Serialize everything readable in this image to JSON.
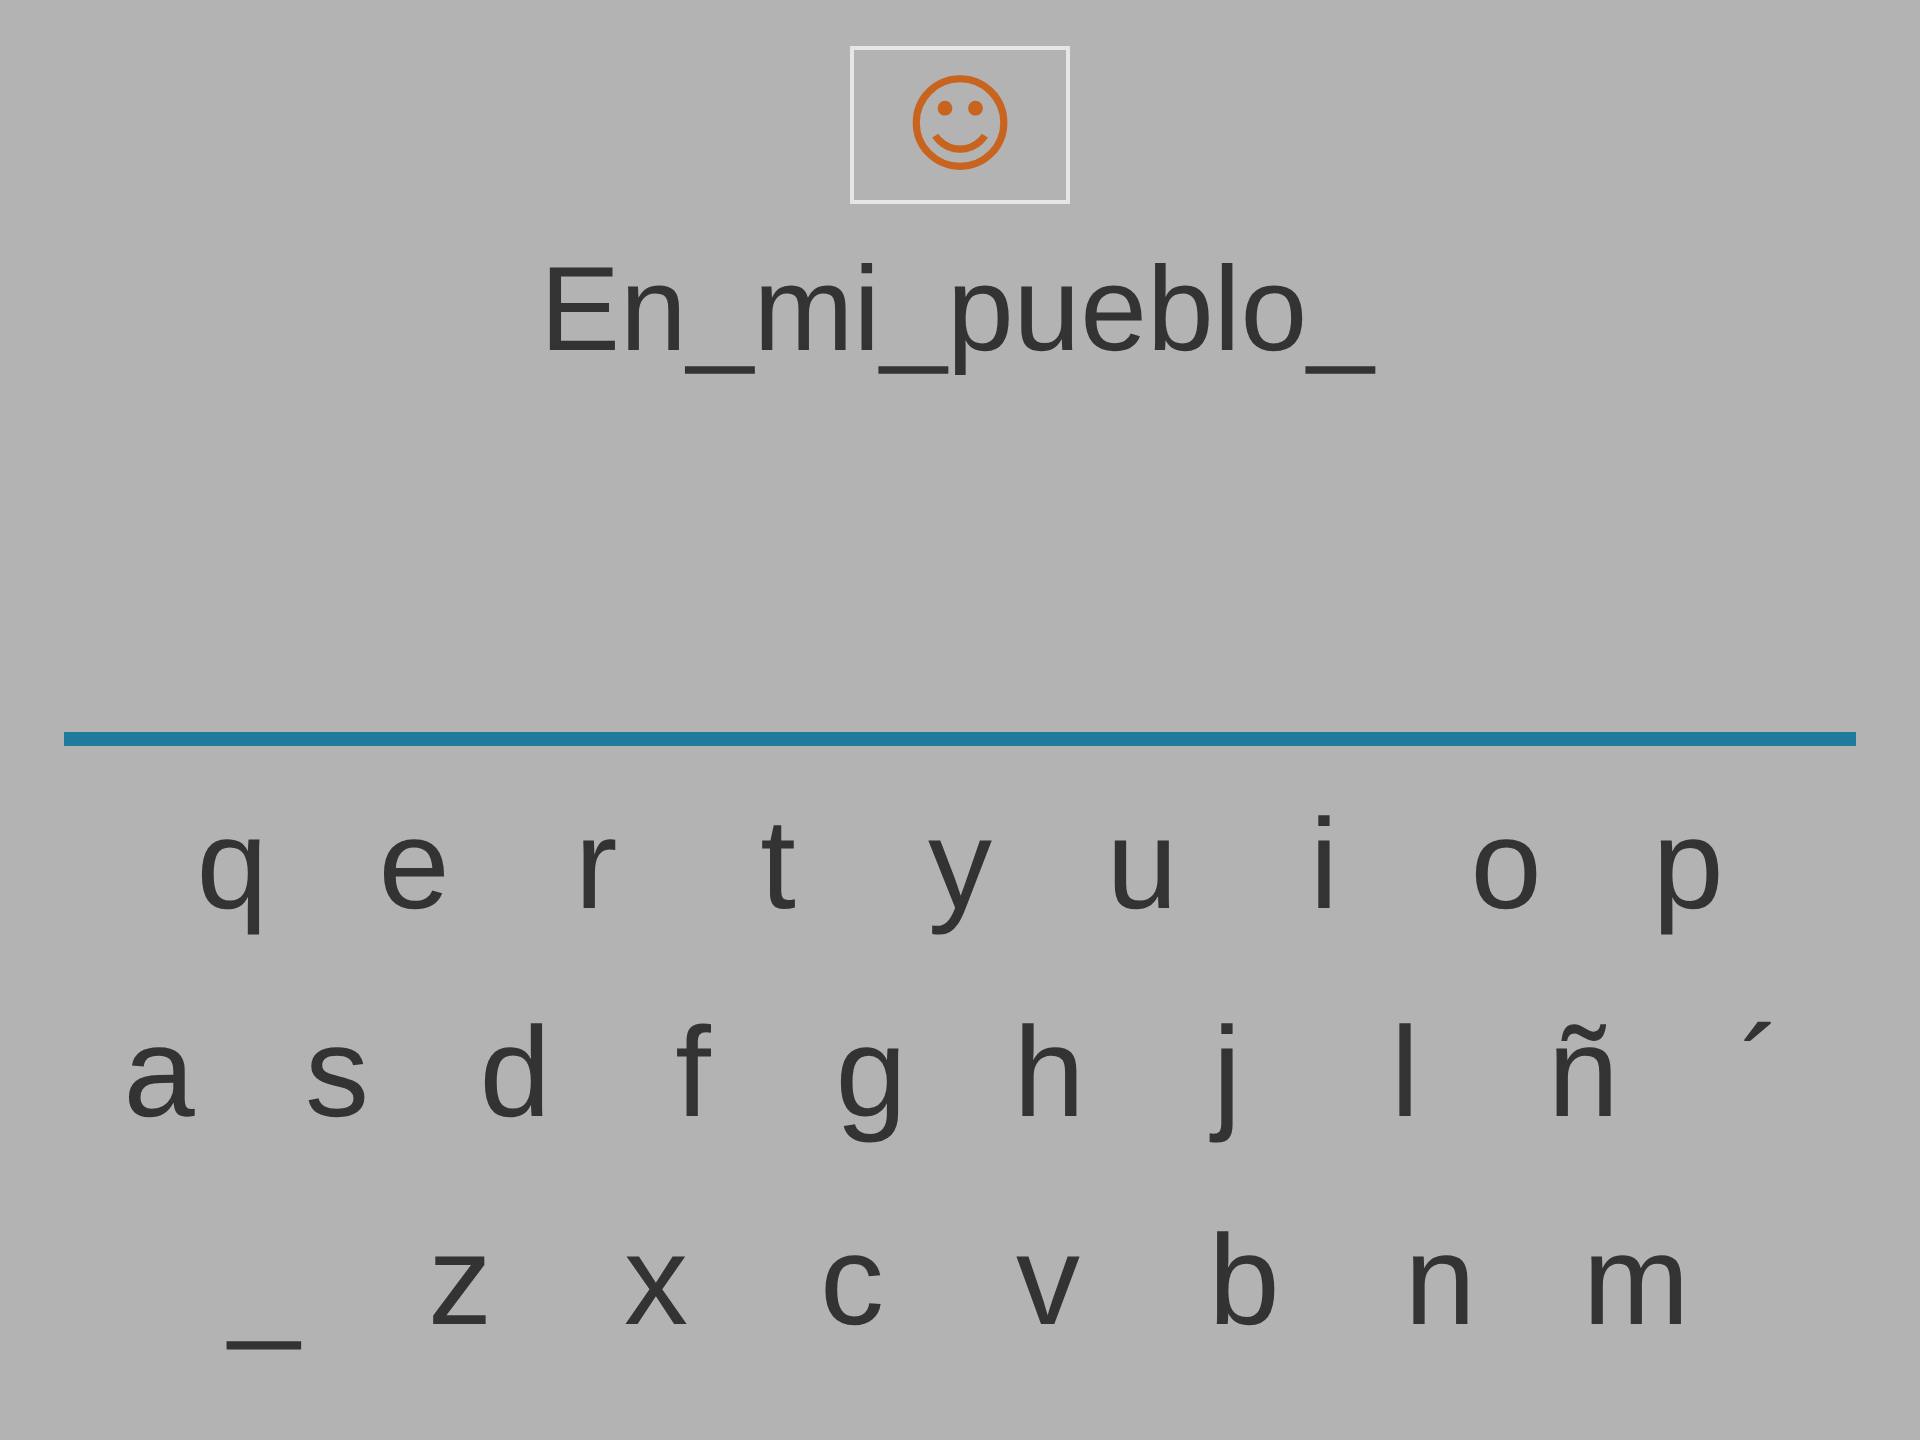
{
  "hint_box": {
    "icon": "☺"
  },
  "sentence": "En_mi_pueblo_",
  "keyboard": {
    "rows": [
      [
        "q",
        "e",
        "r",
        "t",
        "y",
        "u",
        "i",
        "o",
        "p"
      ],
      [
        "a",
        "s",
        "d",
        "f",
        "g",
        "h",
        "j",
        "l",
        "ñ",
        "´"
      ],
      [
        "_",
        "z",
        "x",
        "c",
        "v",
        "b",
        "n",
        "m"
      ]
    ]
  }
}
